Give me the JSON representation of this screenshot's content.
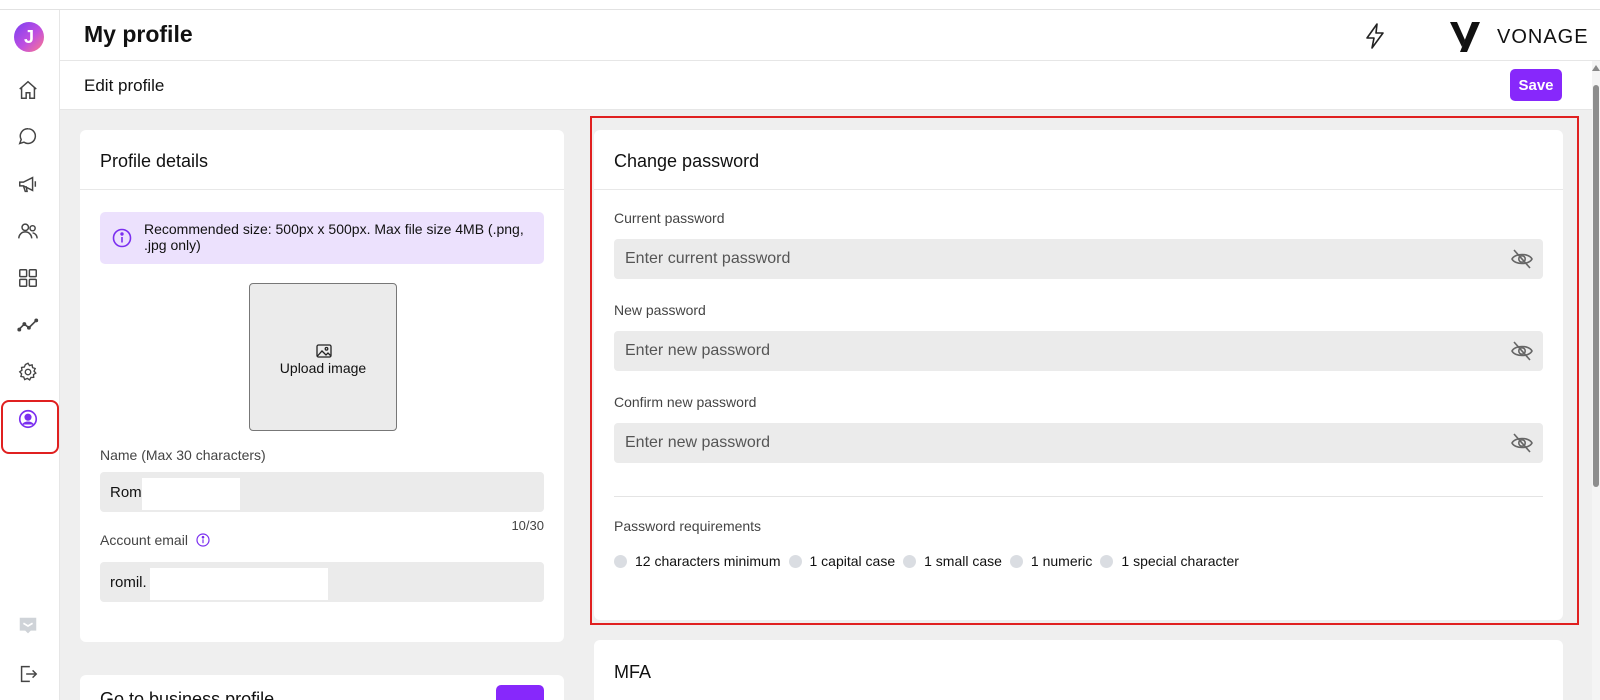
{
  "app": {
    "logo_letter": "J",
    "brand_name": "VONAGE",
    "page_title": "My profile"
  },
  "subheader": {
    "title": "Edit profile",
    "save_label": "Save"
  },
  "sidebar": {
    "items": [
      {
        "name": "home-icon"
      },
      {
        "name": "chat-icon"
      },
      {
        "name": "megaphone-icon"
      },
      {
        "name": "contacts-icon"
      },
      {
        "name": "apps-grid-icon"
      },
      {
        "name": "analytics-icon"
      },
      {
        "name": "settings-gear-icon"
      },
      {
        "name": "profile-icon",
        "active": true
      }
    ],
    "bottom_items": [
      {
        "name": "inbox-icon"
      },
      {
        "name": "logout-icon"
      }
    ]
  },
  "profile_details": {
    "title": "Profile details",
    "info_text": "Recommended size: 500px x 500px. Max file size 4MB (.png, .jpg only)",
    "upload_label": "Upload image",
    "name_label": "Name (Max 30 characters)",
    "name_value": "Rom",
    "name_counter": "10/30",
    "email_label": "Account email",
    "email_value": "romil."
  },
  "business_profile": {
    "label": "Go to business profile",
    "arrow": "→"
  },
  "change_password": {
    "title": "Change password",
    "current_label": "Current password",
    "current_placeholder": "Enter current password",
    "new_label": "New password",
    "new_placeholder": "Enter new password",
    "confirm_label": "Confirm new password",
    "confirm_placeholder": "Enter new password",
    "requirements_title": "Password requirements",
    "requirements": [
      "12 characters minimum",
      "1 capital case",
      "1 small case",
      "1 numeric",
      "1 special character"
    ]
  },
  "mfa": {
    "title": "MFA"
  },
  "colors": {
    "accent": "#8728fb",
    "highlight": "#e02020",
    "info_bg": "#ece1fd",
    "field_bg": "#ebebeb"
  }
}
